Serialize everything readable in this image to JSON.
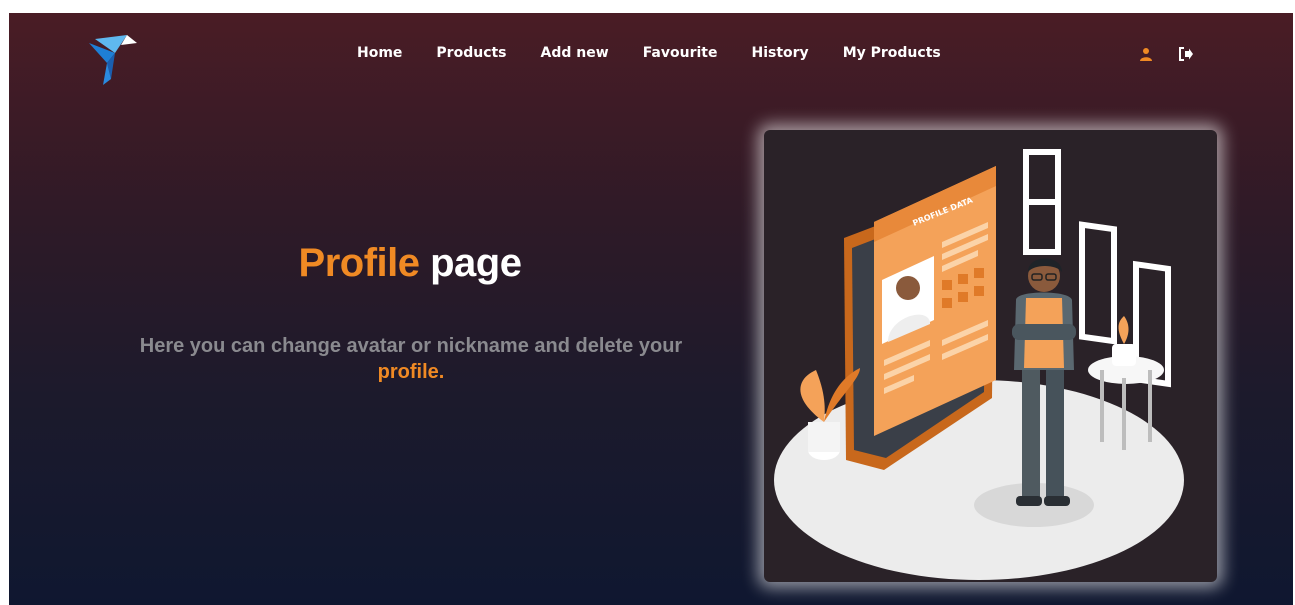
{
  "nav": {
    "items": [
      {
        "label": "Home"
      },
      {
        "label": "Products"
      },
      {
        "label": "Add new"
      },
      {
        "label": "Favourite"
      },
      {
        "label": "History"
      },
      {
        "label": "My Products"
      }
    ]
  },
  "header_icons": {
    "user_icon": "user-icon",
    "logout_icon": "sign-out-icon",
    "user_icon_color": "#f08a24",
    "logout_icon_color": "#ffffff"
  },
  "hero": {
    "title_accent": "Profile",
    "title_rest": "page",
    "description": "Here you can change avatar or nickname and delete your",
    "description_highlight": "profile."
  },
  "illustration": {
    "card_title": "PROFILE DATA"
  },
  "colors": {
    "accent": "#f08a24",
    "background_top": "#4a1c25",
    "background_bottom": "#0f1730",
    "muted_text": "#8a8a8f"
  }
}
